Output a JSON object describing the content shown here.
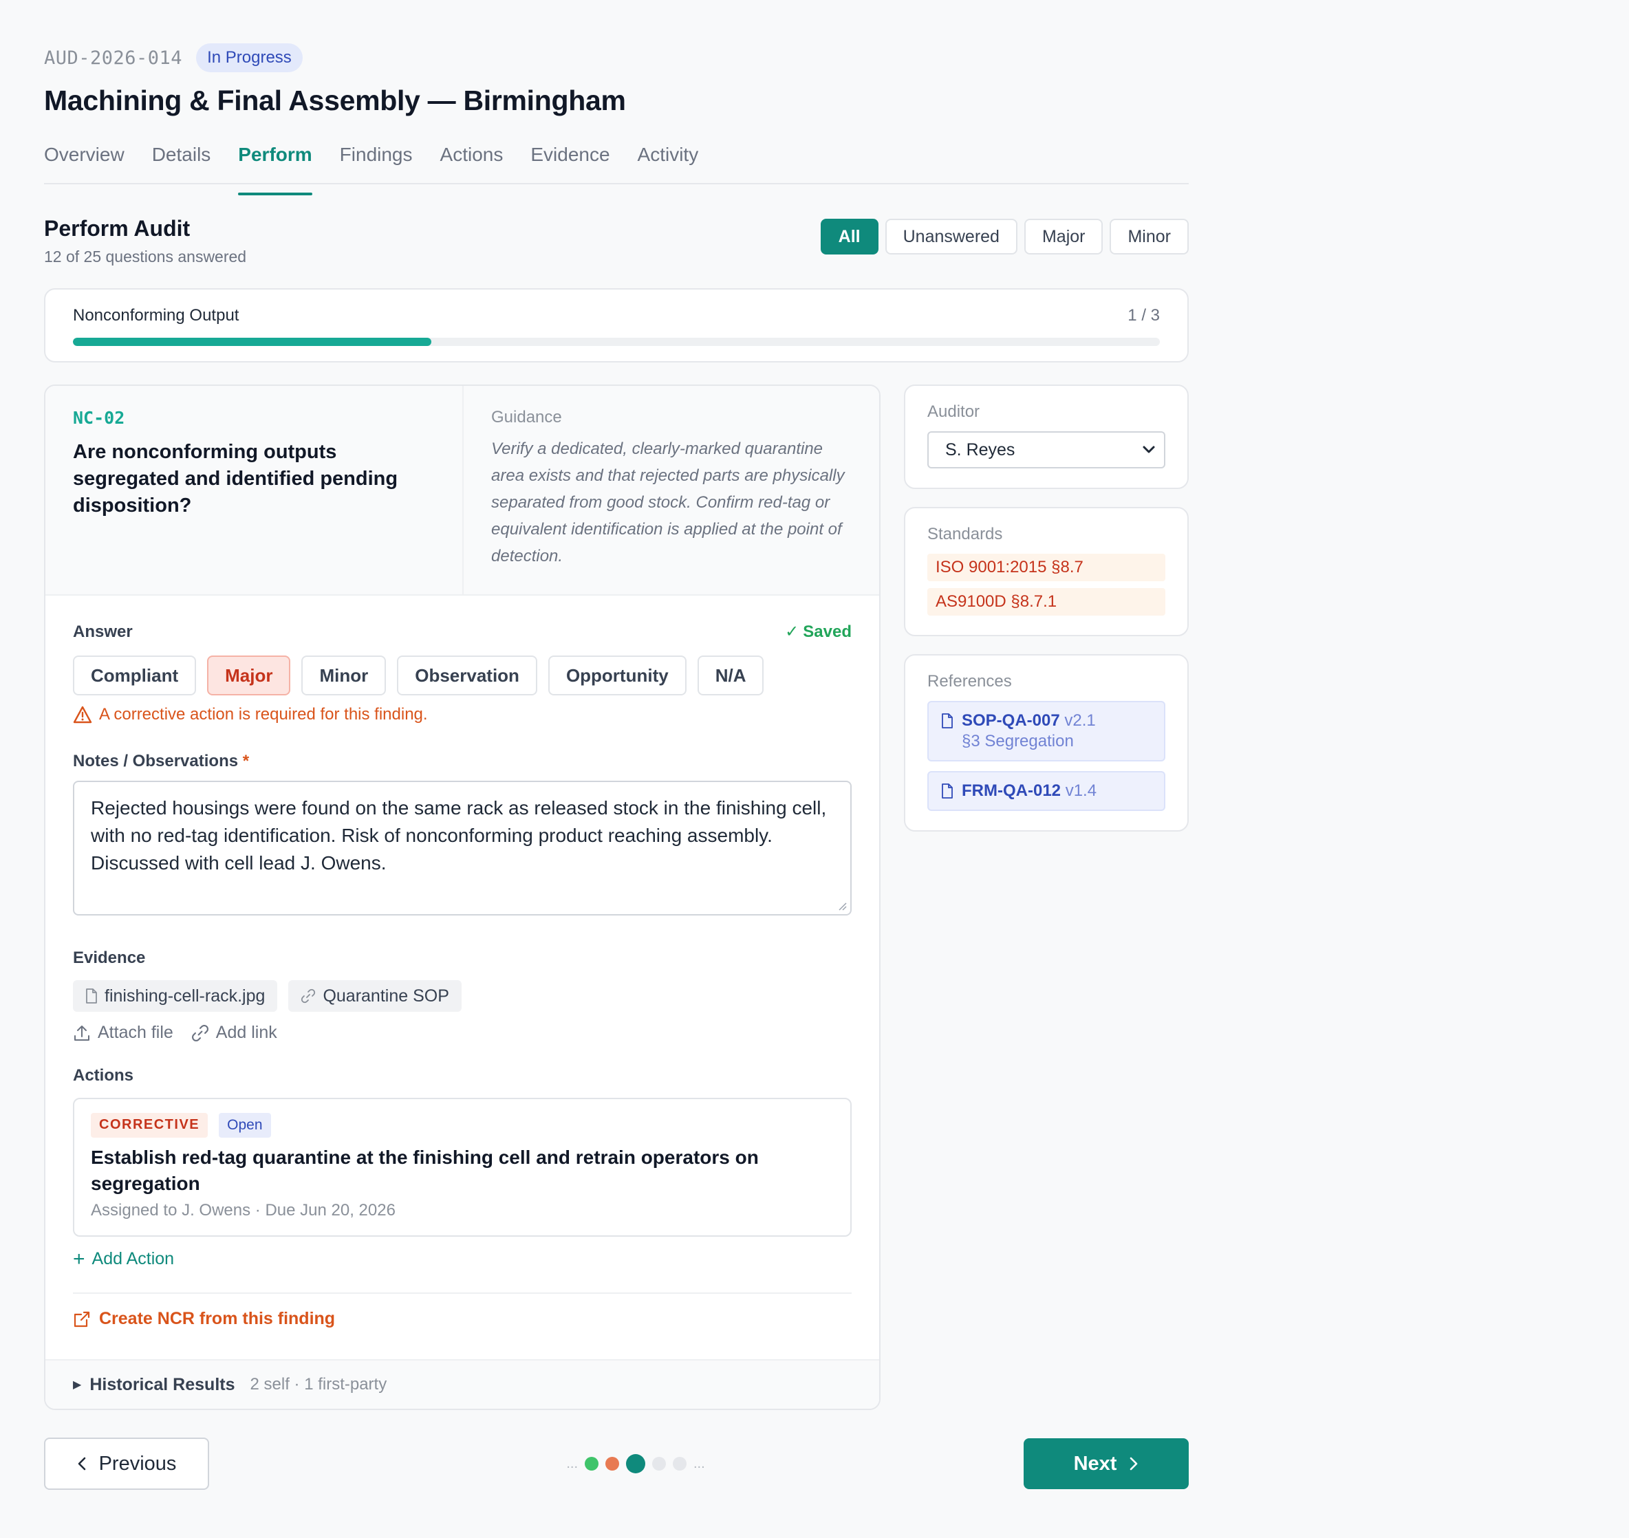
{
  "header": {
    "audit_id": "AUD-2026-014",
    "status": "In Progress",
    "title": "Machining & Final Assembly — Birmingham"
  },
  "tabs": [
    "Overview",
    "Details",
    "Perform",
    "Findings",
    "Actions",
    "Evidence",
    "Activity"
  ],
  "active_tab": "Perform",
  "section": {
    "title": "Perform Audit",
    "subtitle": "12 of 25 questions answered"
  },
  "filters": [
    "All",
    "Unanswered",
    "Major",
    "Minor"
  ],
  "active_filter": "All",
  "progress": {
    "label": "Nonconforming Output",
    "count": "1 / 3",
    "fraction": 0.33
  },
  "question": {
    "code": "NC-02",
    "text": "Are nonconforming outputs segregated and identified pending disposition?",
    "guidance_label": "Guidance",
    "guidance": "Verify a dedicated, clearly-marked quarantine area exists and that rejected parts are physically separated from good stock. Confirm red-tag or equivalent identification is applied at the point of detection."
  },
  "answer": {
    "label": "Answer",
    "saved": "Saved",
    "options": [
      "Compliant",
      "Major",
      "Minor",
      "Observation",
      "Opportunity",
      "N/A"
    ],
    "selected": "Major",
    "warning": "A corrective action is required for this finding."
  },
  "notes": {
    "label": "Notes / Observations",
    "required_mark": "*",
    "value": "Rejected housings were found on the same rack as released stock in the finishing cell, with no red-tag identification. Risk of nonconforming product reaching assembly. Discussed with cell lead J. Owens."
  },
  "evidence": {
    "label": "Evidence",
    "items": [
      {
        "name": "finishing-cell-rack.jpg",
        "icon": "file-icon"
      },
      {
        "name": "Quarantine SOP",
        "icon": "link-icon"
      }
    ],
    "attach_file": "Attach file",
    "add_link": "Add link"
  },
  "actions": {
    "label": "Actions",
    "items": [
      {
        "type": "CORRECTIVE",
        "status": "Open",
        "title": "Establish red-tag quarantine at the finishing cell and retrain operators on segregation",
        "meta": "Assigned to J. Owens · Due Jun 20, 2026"
      }
    ],
    "add_action": "Add Action",
    "create_ncr": "Create NCR from this finding"
  },
  "history": {
    "title": "Historical Results",
    "meta": "2 self · 1 first-party"
  },
  "side": {
    "auditor_label": "Auditor",
    "auditor_value": "S. Reyes",
    "standards_label": "Standards",
    "standards": [
      "ISO 9001:2015 §8.7",
      "AS9100D §8.7.1"
    ],
    "references_label": "References",
    "references": [
      {
        "code": "SOP-QA-007",
        "version": "v2.1",
        "section": "§3 Segregation"
      },
      {
        "code": "FRM-QA-012",
        "version": "v1.4",
        "section": ""
      }
    ]
  },
  "footer": {
    "previous": "Previous",
    "next": "Next",
    "ellipsis": "...",
    "dots": [
      {
        "color": "#3fc46a",
        "current": false
      },
      {
        "color": "#e87a52",
        "current": false
      },
      {
        "color": "#0f8a7c",
        "current": true
      },
      {
        "color": "#e5e7eb",
        "current": false
      },
      {
        "color": "#e5e7eb",
        "current": false
      }
    ]
  },
  "colors": {
    "accent": "#0f8a7c",
    "major": "#c5331b",
    "warning": "#d9541b",
    "saved": "#22a55a"
  }
}
